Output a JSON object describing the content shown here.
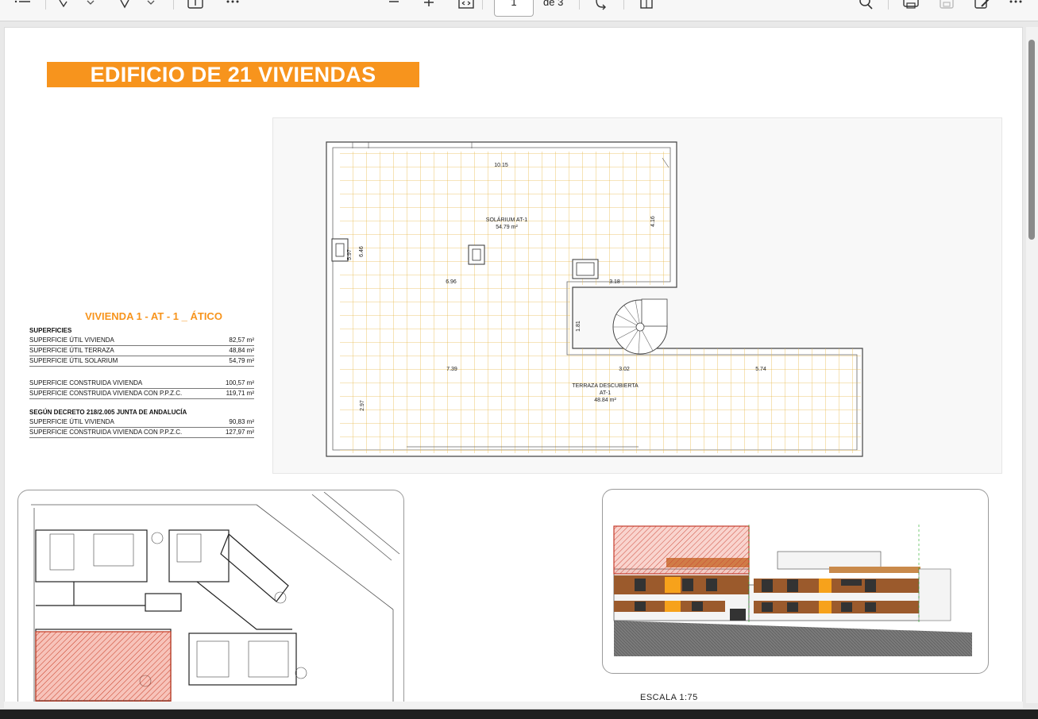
{
  "toolbar": {
    "page_number": "1",
    "page_total": "de 3",
    "icons": [
      "list-icon",
      "draw-icon",
      "chevron-down-icon",
      "highlight-icon",
      "chevron-down-icon",
      "text-box-icon",
      "more-icon",
      "zoom-out-icon",
      "zoom-in-icon",
      "fit-page-icon",
      "rotate-icon",
      "two-page-icon",
      "search-icon",
      "print-icon",
      "save-icon",
      "edit-icon",
      "more-icon"
    ]
  },
  "document": {
    "title": "EDIFICIO DE 21 VIVIENDAS",
    "plan": {
      "dimensions": [
        "10.15",
        "4.16",
        "5.97",
        "6.46",
        "6.96",
        "3.18",
        "1.81",
        "7.39",
        "3.02",
        "5.74",
        "2.97"
      ],
      "solarium_name": "SOLÁRIUM AT-1",
      "solarium_area": "54.79 m²",
      "terrace_name": "TERRAZA DESCUBIERTA",
      "terrace_id": "AT-1",
      "terrace_area": "48.84 m²"
    },
    "areas": {
      "heading": "VIVIENDA 1 - AT - 1 _ ÁTICO",
      "section_label": "SUPERFICIES",
      "rows_util": [
        {
          "label": "SUPERFICIE ÚTIL VIVIENDA",
          "value": "82,57 m²"
        },
        {
          "label": "SUPERFICIE ÚTIL TERRAZA",
          "value": "48,84 m²"
        },
        {
          "label": "SUPERFICIE ÚTIL SOLARIUM",
          "value": "54,79 m²"
        }
      ],
      "rows_built": [
        {
          "label": "SUPERFICIE CONSTRUIDA VIVIENDA",
          "value": "100,57 m²"
        },
        {
          "label": "SUPERFICIE CONSTRUIDA VIVIENDA CON P.P.Z.C.",
          "value": "119,71 m²"
        }
      ],
      "decree_label": "SEGÚN DECRETO 218/2.005 JUNTA DE ANDALUCÍA",
      "rows_decree": [
        {
          "label": "SUPERFICIE ÚTIL VIVIENDA",
          "value": "90,83 m²"
        },
        {
          "label": "SUPERFICIE CONSTRUIDA VIVIENDA CON P.P.Z.C.",
          "value": "127,97 m²"
        }
      ]
    },
    "scale": "ESCALA 1:75",
    "colors": {
      "accent": "#f7941d",
      "highlight": "#e8543a",
      "grid": "#e8b94a"
    }
  }
}
